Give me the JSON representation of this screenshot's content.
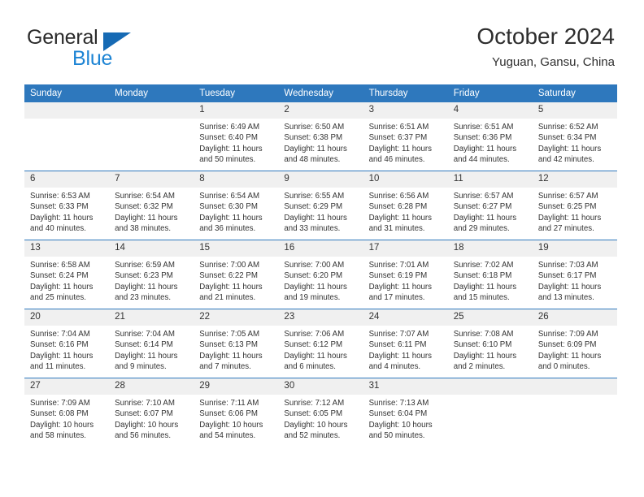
{
  "brand": {
    "name_top": "General",
    "name_bottom": "Blue",
    "logo_icon": "triangle-logo-icon",
    "color_blue": "#1d84d4",
    "color_triangle": "#166ab4"
  },
  "header": {
    "title": "October 2024",
    "subtitle": "Yuguan, Gansu, China"
  },
  "theme": {
    "header_blue": "#2e78bd",
    "daynum_bg": "#f0f0f0",
    "text": "#333333"
  },
  "weekdays": [
    "Sunday",
    "Monday",
    "Tuesday",
    "Wednesday",
    "Thursday",
    "Friday",
    "Saturday"
  ],
  "weeks": [
    [
      {
        "day": "",
        "text": ""
      },
      {
        "day": "",
        "text": ""
      },
      {
        "day": "1",
        "text": "Sunrise: 6:49 AM\nSunset: 6:40 PM\nDaylight: 11 hours\nand 50 minutes."
      },
      {
        "day": "2",
        "text": "Sunrise: 6:50 AM\nSunset: 6:38 PM\nDaylight: 11 hours\nand 48 minutes."
      },
      {
        "day": "3",
        "text": "Sunrise: 6:51 AM\nSunset: 6:37 PM\nDaylight: 11 hours\nand 46 minutes."
      },
      {
        "day": "4",
        "text": "Sunrise: 6:51 AM\nSunset: 6:36 PM\nDaylight: 11 hours\nand 44 minutes."
      },
      {
        "day": "5",
        "text": "Sunrise: 6:52 AM\nSunset: 6:34 PM\nDaylight: 11 hours\nand 42 minutes."
      }
    ],
    [
      {
        "day": "6",
        "text": "Sunrise: 6:53 AM\nSunset: 6:33 PM\nDaylight: 11 hours\nand 40 minutes."
      },
      {
        "day": "7",
        "text": "Sunrise: 6:54 AM\nSunset: 6:32 PM\nDaylight: 11 hours\nand 38 minutes."
      },
      {
        "day": "8",
        "text": "Sunrise: 6:54 AM\nSunset: 6:30 PM\nDaylight: 11 hours\nand 36 minutes."
      },
      {
        "day": "9",
        "text": "Sunrise: 6:55 AM\nSunset: 6:29 PM\nDaylight: 11 hours\nand 33 minutes."
      },
      {
        "day": "10",
        "text": "Sunrise: 6:56 AM\nSunset: 6:28 PM\nDaylight: 11 hours\nand 31 minutes."
      },
      {
        "day": "11",
        "text": "Sunrise: 6:57 AM\nSunset: 6:27 PM\nDaylight: 11 hours\nand 29 minutes."
      },
      {
        "day": "12",
        "text": "Sunrise: 6:57 AM\nSunset: 6:25 PM\nDaylight: 11 hours\nand 27 minutes."
      }
    ],
    [
      {
        "day": "13",
        "text": "Sunrise: 6:58 AM\nSunset: 6:24 PM\nDaylight: 11 hours\nand 25 minutes."
      },
      {
        "day": "14",
        "text": "Sunrise: 6:59 AM\nSunset: 6:23 PM\nDaylight: 11 hours\nand 23 minutes."
      },
      {
        "day": "15",
        "text": "Sunrise: 7:00 AM\nSunset: 6:22 PM\nDaylight: 11 hours\nand 21 minutes."
      },
      {
        "day": "16",
        "text": "Sunrise: 7:00 AM\nSunset: 6:20 PM\nDaylight: 11 hours\nand 19 minutes."
      },
      {
        "day": "17",
        "text": "Sunrise: 7:01 AM\nSunset: 6:19 PM\nDaylight: 11 hours\nand 17 minutes."
      },
      {
        "day": "18",
        "text": "Sunrise: 7:02 AM\nSunset: 6:18 PM\nDaylight: 11 hours\nand 15 minutes."
      },
      {
        "day": "19",
        "text": "Sunrise: 7:03 AM\nSunset: 6:17 PM\nDaylight: 11 hours\nand 13 minutes."
      }
    ],
    [
      {
        "day": "20",
        "text": "Sunrise: 7:04 AM\nSunset: 6:16 PM\nDaylight: 11 hours\nand 11 minutes."
      },
      {
        "day": "21",
        "text": "Sunrise: 7:04 AM\nSunset: 6:14 PM\nDaylight: 11 hours\nand 9 minutes."
      },
      {
        "day": "22",
        "text": "Sunrise: 7:05 AM\nSunset: 6:13 PM\nDaylight: 11 hours\nand 7 minutes."
      },
      {
        "day": "23",
        "text": "Sunrise: 7:06 AM\nSunset: 6:12 PM\nDaylight: 11 hours\nand 6 minutes."
      },
      {
        "day": "24",
        "text": "Sunrise: 7:07 AM\nSunset: 6:11 PM\nDaylight: 11 hours\nand 4 minutes."
      },
      {
        "day": "25",
        "text": "Sunrise: 7:08 AM\nSunset: 6:10 PM\nDaylight: 11 hours\nand 2 minutes."
      },
      {
        "day": "26",
        "text": "Sunrise: 7:09 AM\nSunset: 6:09 PM\nDaylight: 11 hours\nand 0 minutes."
      }
    ],
    [
      {
        "day": "27",
        "text": "Sunrise: 7:09 AM\nSunset: 6:08 PM\nDaylight: 10 hours\nand 58 minutes."
      },
      {
        "day": "28",
        "text": "Sunrise: 7:10 AM\nSunset: 6:07 PM\nDaylight: 10 hours\nand 56 minutes."
      },
      {
        "day": "29",
        "text": "Sunrise: 7:11 AM\nSunset: 6:06 PM\nDaylight: 10 hours\nand 54 minutes."
      },
      {
        "day": "30",
        "text": "Sunrise: 7:12 AM\nSunset: 6:05 PM\nDaylight: 10 hours\nand 52 minutes."
      },
      {
        "day": "31",
        "text": "Sunrise: 7:13 AM\nSunset: 6:04 PM\nDaylight: 10 hours\nand 50 minutes."
      },
      {
        "day": "",
        "text": ""
      },
      {
        "day": "",
        "text": ""
      }
    ]
  ]
}
